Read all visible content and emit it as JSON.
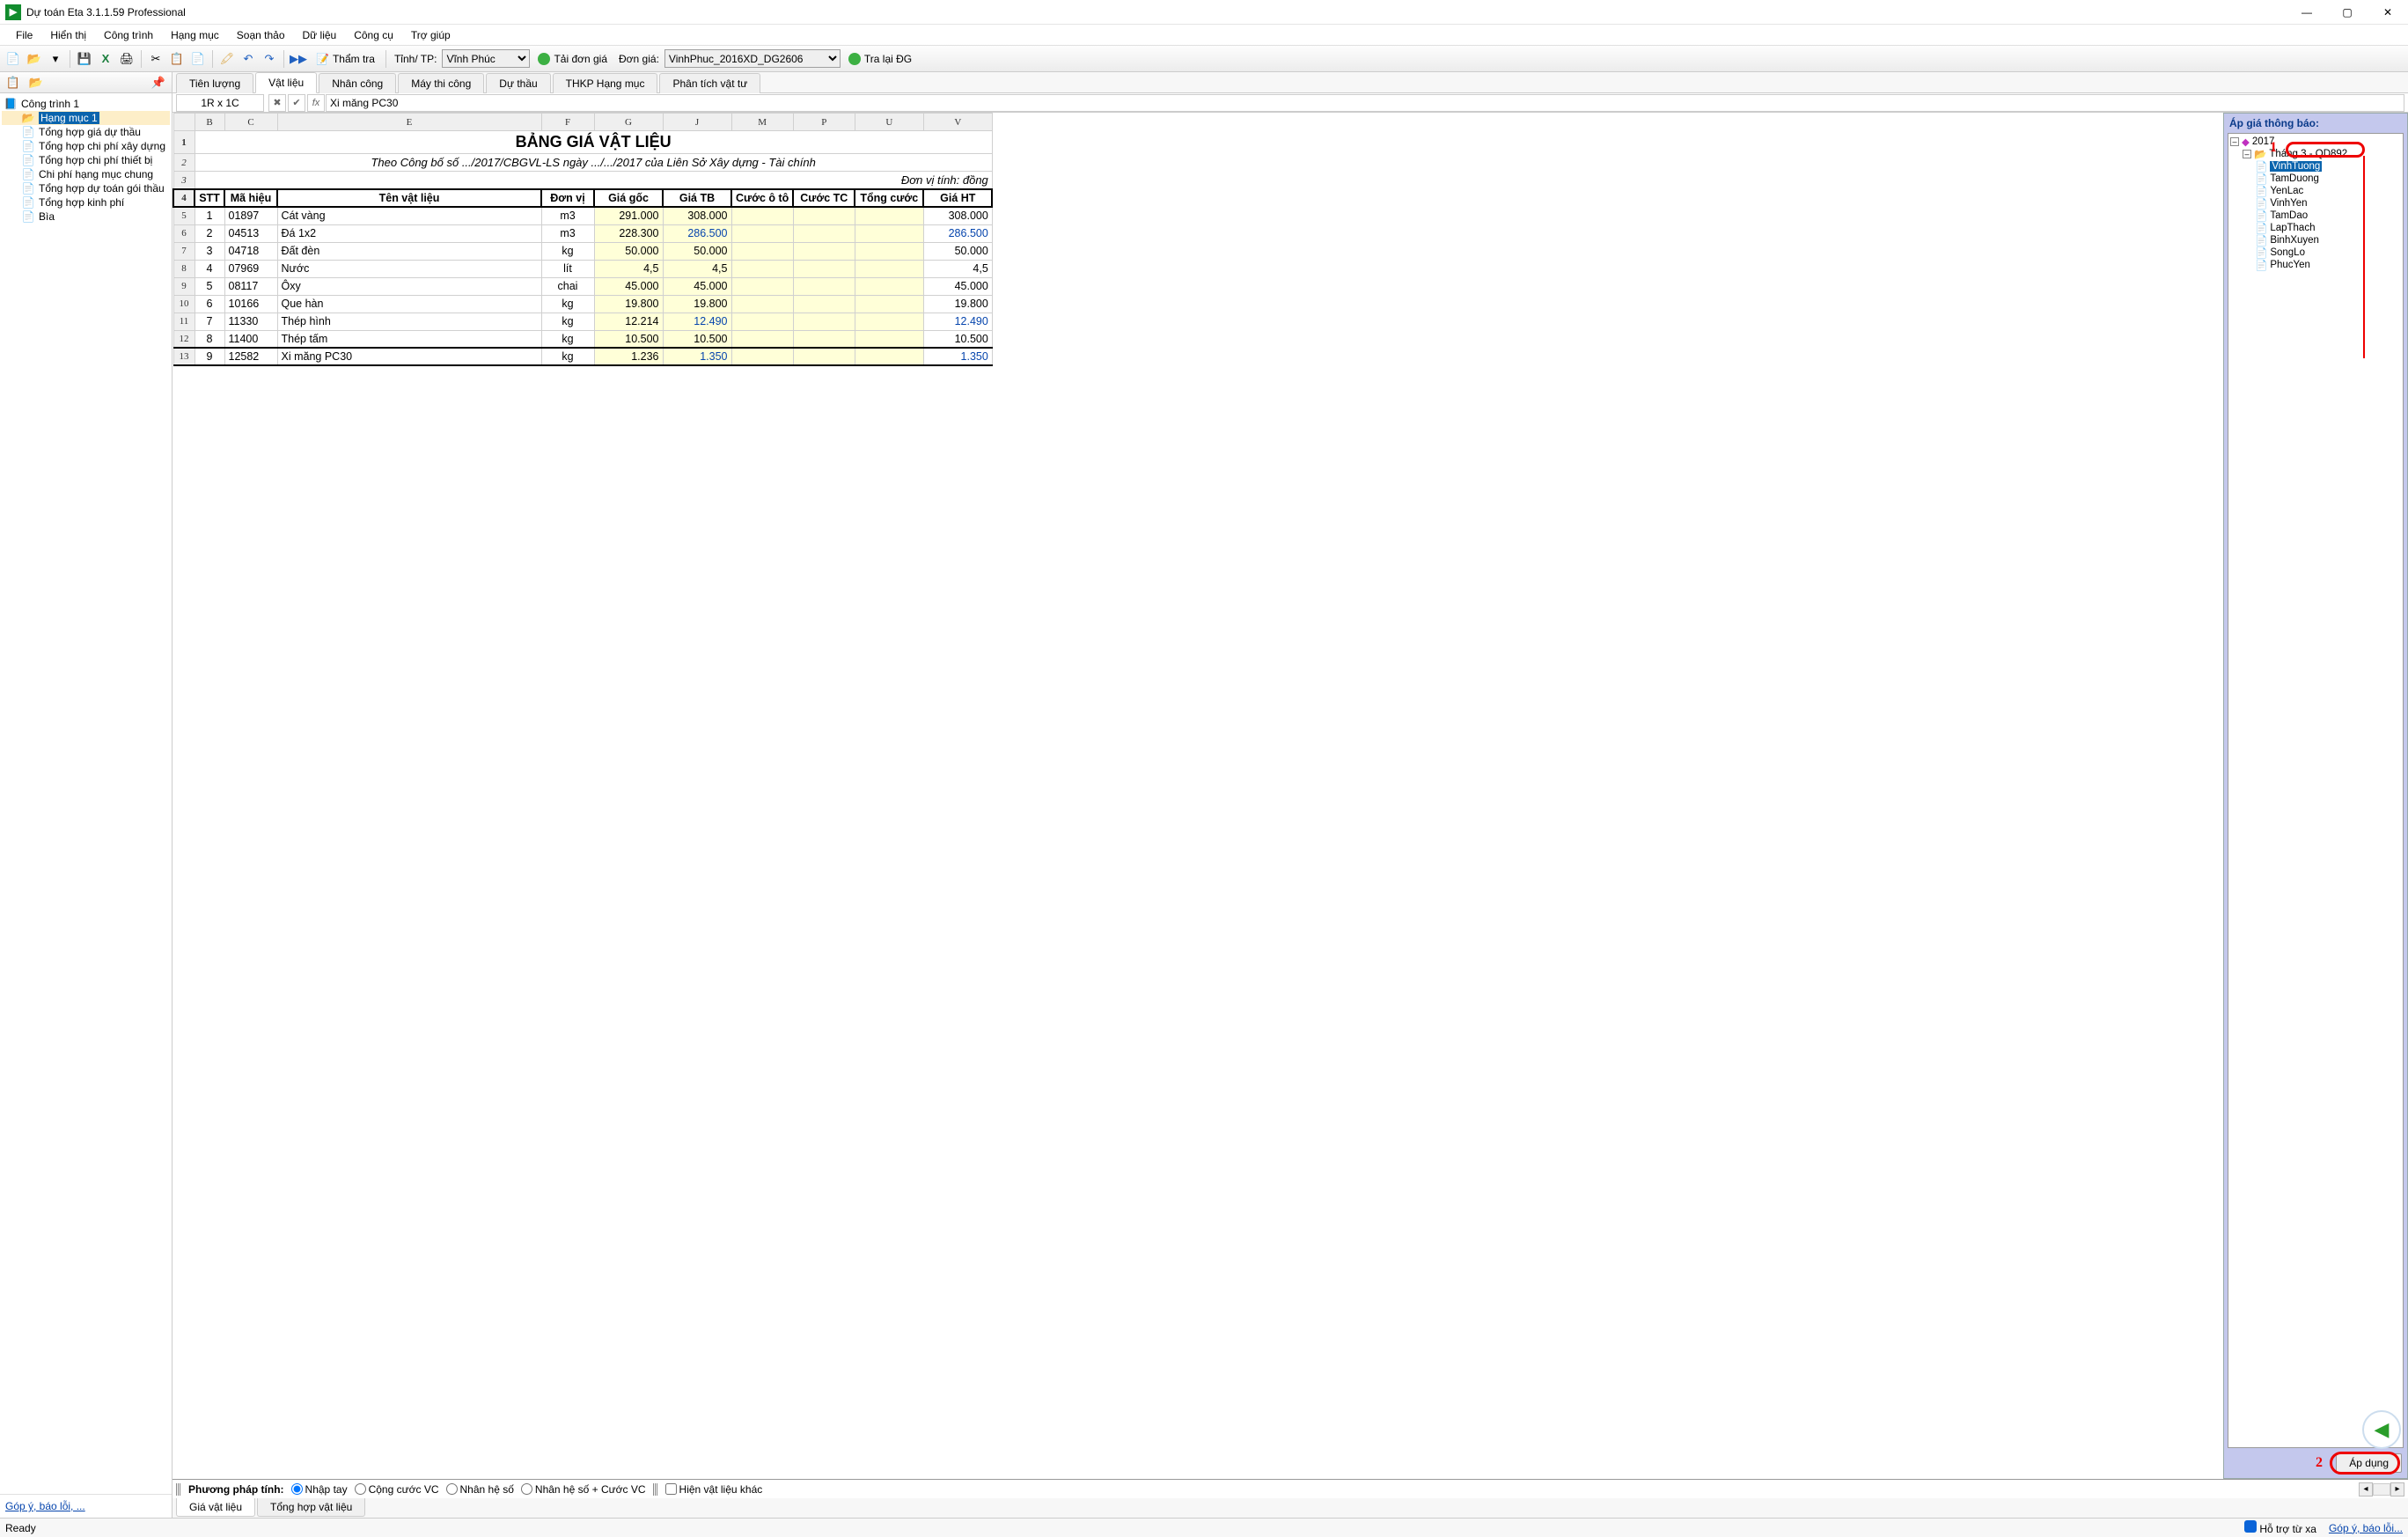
{
  "window": {
    "title": "Dự toán Eta 3.1.1.59 Professional"
  },
  "menubar": [
    "File",
    "Hiển thị",
    "Công trình",
    "Hạng mục",
    "Soạn thảo",
    "Dữ liệu",
    "Công cụ",
    "Trợ giúp"
  ],
  "toolbar": {
    "tham_tra": "Thẩm tra",
    "tinh_tp_label": "Tỉnh/ TP:",
    "tinh_tp_value": "Vĩnh Phúc",
    "tai_don_gia": "Tải đơn giá",
    "don_gia_label": "Đơn giá:",
    "don_gia_value": "VinhPhuc_2016XD_DG2606",
    "tra_lai_dg": "Tra lại ĐG"
  },
  "left_tree": {
    "root": "Công trình 1",
    "items": [
      "Hạng mục 1",
      "Tổng hợp giá dự thầu",
      "Tổng hợp chi phí xây dựng",
      "Tổng hợp chi phí thiết bị",
      "Chi phí hạng mục chung",
      "Tổng hợp dự toán gói thầu",
      "Tổng hợp kinh phí",
      "Bìa"
    ],
    "footer_link": "Góp ý, báo lỗi, ..."
  },
  "sheet_tabs": [
    "Tiên lượng",
    "Vật liệu",
    "Nhân công",
    "Máy thi công",
    "Dự thầu",
    "THKP Hạng mục",
    "Phân tích vật tư"
  ],
  "sheet_tabs_active": 1,
  "formula_bar": {
    "cell_ref": "1R x 1C",
    "fx_value": "Xi măng PC30"
  },
  "columns": [
    "B",
    "C",
    "E",
    "F",
    "G",
    "J",
    "M",
    "P",
    "U",
    "V"
  ],
  "sheet": {
    "title": "BẢNG GIÁ VẬT LIỆU",
    "subtitle": "Theo Công bố số .../2017/CBGVL-LS ngày .../.../2017 của Liên Sở Xây dựng - Tài chính",
    "unit": "Đơn vị tính: đồng",
    "headers": [
      "STT",
      "Mã hiệu",
      "Tên vật liệu",
      "Đơn vị",
      "Giá gốc",
      "Giá TB",
      "Cước ô tô",
      "Cước TC",
      "Tổng cước",
      "Giá HT"
    ],
    "rows": [
      {
        "stt": "1",
        "ma": "01897",
        "ten": "Cát vàng",
        "dv": "m3",
        "goc": "291.000",
        "tb": "308.000",
        "ht": "308.000",
        "blue": false
      },
      {
        "stt": "2",
        "ma": "04513",
        "ten": "Đá 1x2",
        "dv": "m3",
        "goc": "228.300",
        "tb": "286.500",
        "ht": "286.500",
        "blue": true
      },
      {
        "stt": "3",
        "ma": "04718",
        "ten": "Đất đèn",
        "dv": "kg",
        "goc": "50.000",
        "tb": "50.000",
        "ht": "50.000",
        "blue": false
      },
      {
        "stt": "4",
        "ma": "07969",
        "ten": "Nước",
        "dv": "lít",
        "goc": "4,5",
        "tb": "4,5",
        "ht": "4,5",
        "blue": false
      },
      {
        "stt": "5",
        "ma": "08117",
        "ten": "Ôxy",
        "dv": "chai",
        "goc": "45.000",
        "tb": "45.000",
        "ht": "45.000",
        "blue": false
      },
      {
        "stt": "6",
        "ma": "10166",
        "ten": "Que hàn",
        "dv": "kg",
        "goc": "19.800",
        "tb": "19.800",
        "ht": "19.800",
        "blue": false
      },
      {
        "stt": "7",
        "ma": "11330",
        "ten": "Thép hình",
        "dv": "kg",
        "goc": "12.214",
        "tb": "12.490",
        "ht": "12.490",
        "blue": true
      },
      {
        "stt": "8",
        "ma": "11400",
        "ten": "Thép tấm",
        "dv": "kg",
        "goc": "10.500",
        "tb": "10.500",
        "ht": "10.500",
        "blue": false
      },
      {
        "stt": "9",
        "ma": "12582",
        "ten": "Xi măng PC30",
        "dv": "kg",
        "goc": "1.236",
        "tb": "1.350",
        "ht": "1.350",
        "blue": true
      }
    ]
  },
  "right_panel": {
    "title": "Áp giá thông báo:",
    "year": "2017",
    "month": "Tháng 3 - QD892",
    "districts": [
      "VinhTuong",
      "TamDuong",
      "YenLac",
      "VinhYen",
      "TamDao",
      "LapThach",
      "BinhXuyen",
      "SongLo",
      "PhucYen"
    ],
    "apply": "Áp dụng",
    "anno1": "1",
    "anno2": "2"
  },
  "method_bar": {
    "label": "Phương pháp tính:",
    "opts": [
      "Nhập tay",
      "Cộng cước VC",
      "Nhân hệ số",
      "Nhân hệ số + Cước VC"
    ],
    "checkbox": "Hiện vật liệu khác"
  },
  "bottom_tabs": [
    "Giá vật liệu",
    "Tổng hợp vật liệu"
  ],
  "statusbar": {
    "ready": "Ready",
    "support": "Hỗ trợ từ xa",
    "feedback": "Góp ý, báo lỗi..."
  }
}
